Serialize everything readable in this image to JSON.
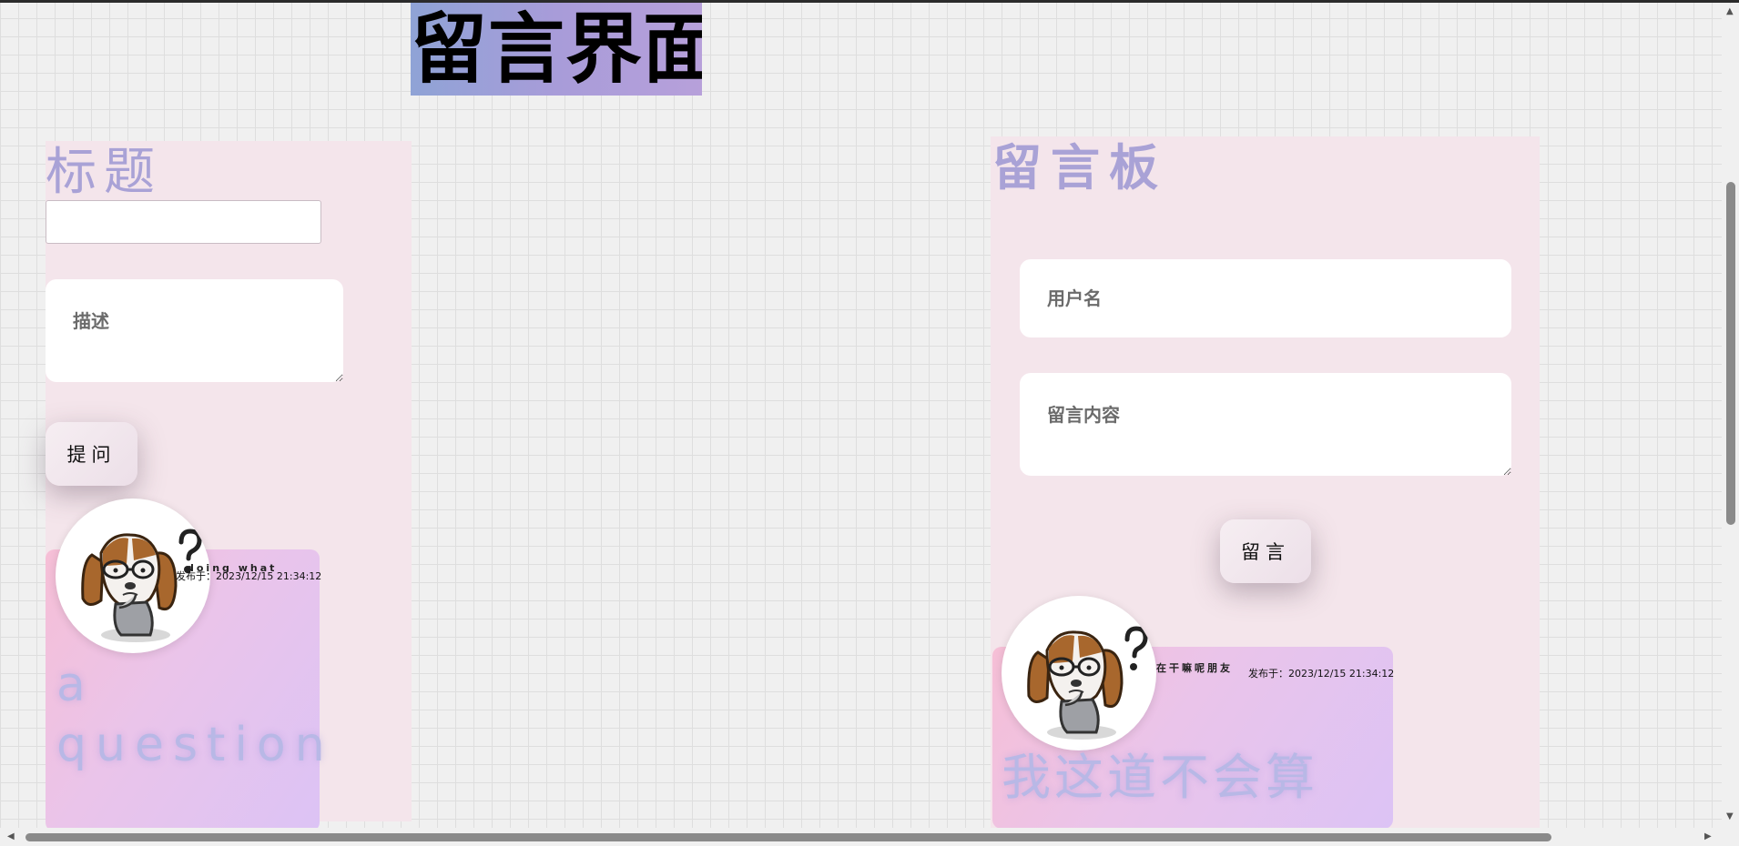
{
  "page": {
    "title": "留言界面"
  },
  "question_panel": {
    "title_label": "标题",
    "title_input_value": "",
    "description_placeholder": "描述",
    "ask_button": "提问",
    "card": {
      "name": "doing what",
      "time": "发布于：2023/12/15 21:34:12",
      "body": "a question"
    }
  },
  "message_panel": {
    "heading": "留言板",
    "username_placeholder": "用户名",
    "content_placeholder": "留言内容",
    "submit_button": "留言",
    "card": {
      "name": "在干嘛呢朋友",
      "time": "发布于：2023/12/15 21:34:12",
      "body": "我这道不会算"
    }
  },
  "icons": {
    "avatar": "confused-dog-avatar-icon",
    "scroll_up": "arrow-up-icon",
    "scroll_down": "arrow-down-icon",
    "scroll_left": "arrow-left-icon",
    "scroll_right": "arrow-right-icon"
  },
  "colors": {
    "title_gradient_start": "#8fa3d6",
    "title_gradient_end": "#b7a0da",
    "panel_bg": "#f4e5eb",
    "label_color": "#a9a2d6",
    "card_gradient_start": "#f6bfd6",
    "card_gradient_end": "#dcc3f5"
  }
}
